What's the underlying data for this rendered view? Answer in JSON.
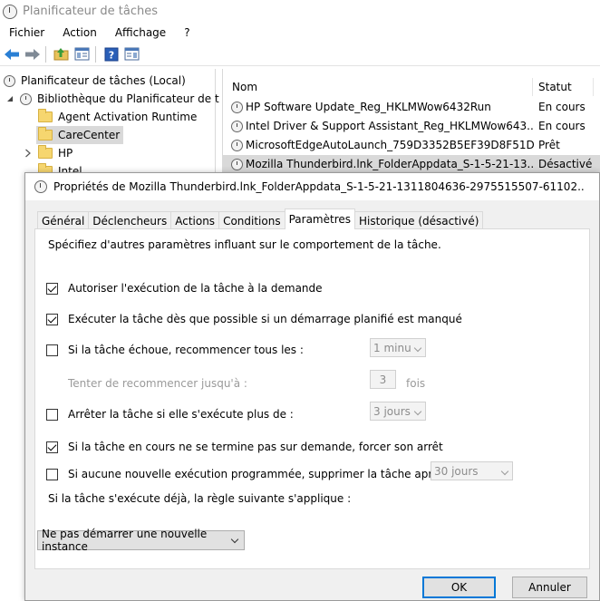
{
  "main_window": {
    "title": "Planificateur de tâches",
    "menu": [
      "Fichier",
      "Action",
      "Affichage",
      "?"
    ]
  },
  "tree": {
    "root": "Planificateur de tâches (Local)",
    "library": "Bibliothèque du Planificateur de t",
    "items": [
      "Agent Activation Runtime",
      "CareCenter",
      "HP",
      "Intel"
    ]
  },
  "task_list": {
    "columns": [
      "Nom",
      "Statut"
    ],
    "rows": [
      {
        "name": "HP Software Update_Reg_HKLMWow6432Run",
        "status": "En cours"
      },
      {
        "name": "Intel Driver & Support Assistant_Reg_HKLMWow643...",
        "status": "En cours"
      },
      {
        "name": "MicrosoftEdgeAutoLaunch_759D3352B5EF39D8F51D...",
        "status": "Prêt"
      },
      {
        "name": "Mozilla Thunderbird.lnk_FolderAppdata_S-1-5-21-13...",
        "status": "Désactivé"
      }
    ]
  },
  "dialog": {
    "title": "Propriétés de Mozilla Thunderbird.lnk_FolderAppdata_S-1-5-21-1311804636-2975515507-61102...",
    "tabs": [
      "Général",
      "Déclencheurs",
      "Actions",
      "Conditions",
      "Paramètres",
      "Historique (désactivé)"
    ],
    "description": "Spécifiez d'autres paramètres influant sur le comportement de la tâche.",
    "options": {
      "allow_on_demand": "Autoriser l'exécution de la tâche à la demande",
      "run_missed": "Exécuter la tâche dès que possible si un démarrage planifié est manqué",
      "restart_on_fail": "Si la tâche échoue, recommencer tous les :",
      "retry_up_to": "Tenter de recommencer jusqu'à :",
      "stop_if_longer": "Arrêter la tâche si elle s'exécute plus de :",
      "force_stop": "Si la tâche en cours ne se termine pas sur demande, forcer son arrêt",
      "delete_after": "Si aucune nouvelle exécution programmée, supprimer la tâche après :"
    },
    "values": {
      "restart_interval": "1 minu",
      "retry_count": "3",
      "retry_unit": "fois",
      "stop_duration": "3 jours",
      "delete_duration": "30 jours"
    },
    "rule_label": "Si la tâche s'exécute déjà, la règle suivante s'applique :",
    "instance_rule": "Ne pas démarrer une nouvelle instance",
    "ok_label": "OK",
    "cancel_label": "Annuler"
  }
}
